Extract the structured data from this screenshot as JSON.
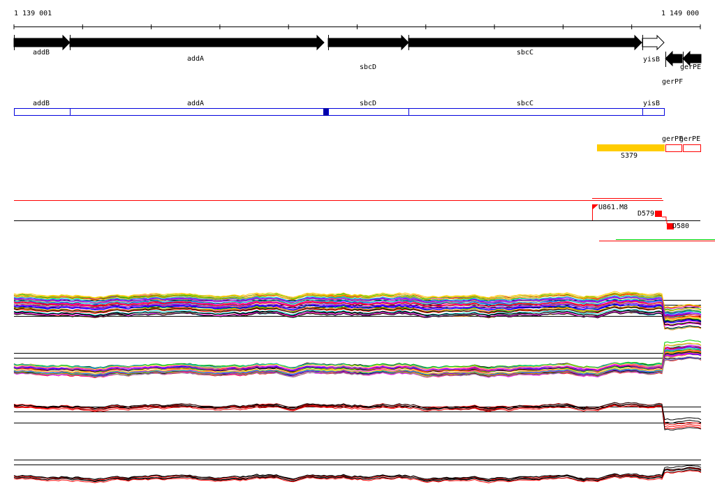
{
  "ruler": {
    "start_label": "1 139 001",
    "end_label": "1 149 000"
  },
  "genes": [
    {
      "name": "addB",
      "strand": "+",
      "filled": true
    },
    {
      "name": "addA",
      "strand": "+",
      "filled": true
    },
    {
      "name": "sbcD",
      "strand": "+",
      "filled": true
    },
    {
      "name": "sbcC",
      "strand": "+",
      "filled": true
    },
    {
      "name": "yisB",
      "strand": "+",
      "filled": false
    },
    {
      "name": "gerPF",
      "strand": "-",
      "filled": true
    },
    {
      "name": "gerPE",
      "strand": "-",
      "filled": true
    }
  ],
  "operon_track": {
    "color": "#0000dd",
    "labels": [
      "addB",
      "addA",
      "sbcD",
      "sbcC",
      "yisB"
    ]
  },
  "segment_track": {
    "segment": {
      "label": "S379",
      "color": "#ffcc00"
    },
    "red_boxes": [
      "gerPF",
      "gerPE"
    ]
  },
  "tss_track": {
    "features": [
      {
        "label": "U861.M8",
        "type": "upstream"
      },
      {
        "label": "D579",
        "type": "downstream"
      },
      {
        "label": "D580",
        "type": "downstream"
      }
    ],
    "color": "#ff0000"
  },
  "expression_tracks": {
    "colors": [
      "#ff0000",
      "#00cc00",
      "#0000ff",
      "#ff00ff",
      "#00cccc",
      "#ffcc00",
      "#000000",
      "#888888",
      "#ff8800",
      "#8800ff"
    ]
  }
}
